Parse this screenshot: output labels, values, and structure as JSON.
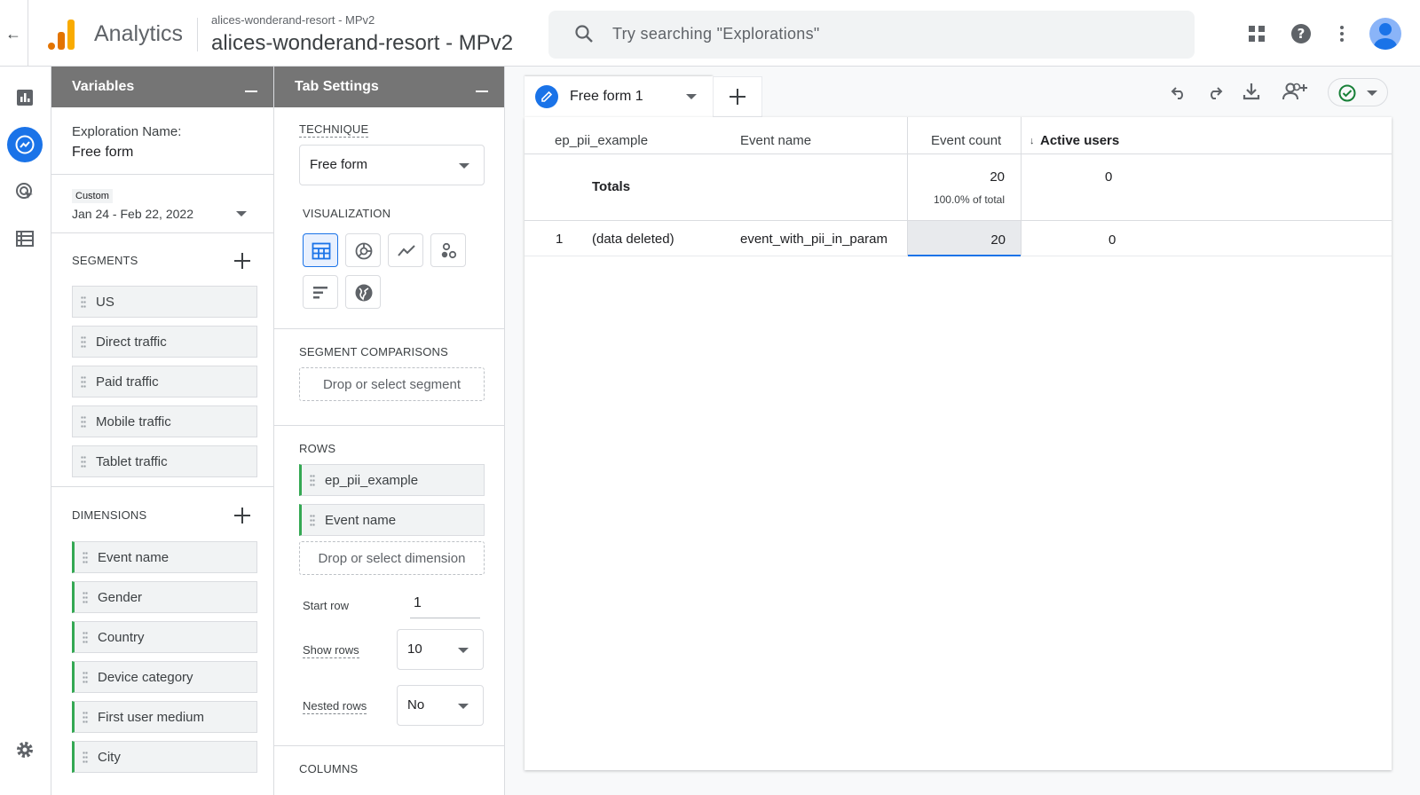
{
  "header": {
    "app_title": "Analytics",
    "account_small": "alices-wonderand-resort - MPv2",
    "account_big": "alices-wonderand-resort - MPv2",
    "search_placeholder": "Try searching \"Explorations\""
  },
  "variables_panel": {
    "title": "Variables",
    "exploration_name_label": "Exploration Name:",
    "exploration_name_value": "Free form",
    "date_badge": "Custom",
    "date_range": "Jan 24 - Feb 22, 2022",
    "segments_label": "SEGMENTS",
    "segments": [
      "US",
      "Direct traffic",
      "Paid traffic",
      "Mobile traffic",
      "Tablet traffic"
    ],
    "dimensions_label": "DIMENSIONS",
    "dimensions": [
      "Event name",
      "Gender",
      "Country",
      "Device category",
      "First user medium",
      "City"
    ]
  },
  "tab_settings": {
    "title": "Tab Settings",
    "technique_label": "TECHNIQUE",
    "technique_value": "Free form",
    "visualization_label": "VISUALIZATION",
    "segment_comparisons_label": "SEGMENT COMPARISONS",
    "segment_drop": "Drop or select segment",
    "rows_label": "ROWS",
    "rows": [
      "ep_pii_example",
      "Event name"
    ],
    "dimension_drop": "Drop or select dimension",
    "start_row_label": "Start row",
    "start_row_value": "1",
    "show_rows_label": "Show rows",
    "show_rows_value": "10",
    "nested_rows_label": "Nested rows",
    "nested_rows_value": "No",
    "columns_label": "COLUMNS"
  },
  "canvas": {
    "tab_label": "Free form 1",
    "headers": {
      "dim1": "ep_pii_example",
      "dim2": "Event name",
      "metric1": "Event count",
      "metric2": "Active users"
    },
    "totals": {
      "label": "Totals",
      "event_count": "20",
      "event_count_pct": "100.0% of total",
      "active_users": "0"
    },
    "rows": [
      {
        "index": "1",
        "dim1": "(data deleted)",
        "dim2": "event_with_pii_in_param",
        "event_count": "20",
        "active_users": "0"
      }
    ]
  },
  "colors": {
    "accent": "#1a73e8",
    "header_gray": "#757575",
    "dimension_green": "#34a853",
    "logo_orange": "#f9ab00",
    "logo_dark_orange": "#e37400"
  }
}
